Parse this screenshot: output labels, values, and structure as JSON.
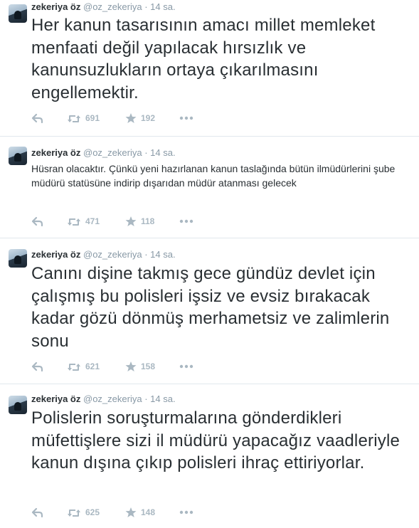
{
  "tweets": [
    {
      "name": "zekeriya öz",
      "handle": "@oz_zekeriya",
      "separator": "·",
      "time": "14 sa.",
      "text": "Her kanun tasarısının amacı millet memleket menfaati değil yapılacak hırsızlık ve kanunsuzlukların ortaya çıkarılmasını engellemektir.",
      "retweets": "691",
      "favorites": "192"
    },
    {
      "name": "zekeriya öz",
      "handle": "@oz_zekeriya",
      "separator": "·",
      "time": "14 sa.",
      "text": "Hüsran olacaktır. Çünkü yeni hazırlanan kanun taslağında bütün ilmüdürlerini şube müdürü statüsüne indirip  dışarıdan müdür atanması gelecek",
      "retweets": "471",
      "favorites": "118"
    },
    {
      "name": "zekeriya öz",
      "handle": "@oz_zekeriya",
      "separator": "·",
      "time": "14 sa.",
      "text": "Canını dişine takmış gece gündüz devlet için çalışmış bu polisleri işsiz ve evsiz bırakacak kadar gözü dönmüş merhametsiz ve zalimlerin sonu",
      "retweets": "621",
      "favorites": "158"
    },
    {
      "name": "zekeriya öz",
      "handle": "@oz_zekeriya",
      "separator": "·",
      "time": "14 sa.",
      "text": "Polislerin soruşturmalarına gönderdikleri müfettişlere sizi il müdürü yapacağız vaadleriyle kanun dışına çıkıp polisleri ihraç ettiriyorlar.",
      "retweets": "625",
      "favorites": "148"
    }
  ],
  "icons": {
    "reply": "reply-icon",
    "retweet": "retweet-icon",
    "favorite": "star-icon",
    "more": "more-icon"
  },
  "colors": {
    "text": "#292f33",
    "muted": "#8899a6",
    "action": "#aab8c2",
    "divider": "#e1e8ed"
  }
}
